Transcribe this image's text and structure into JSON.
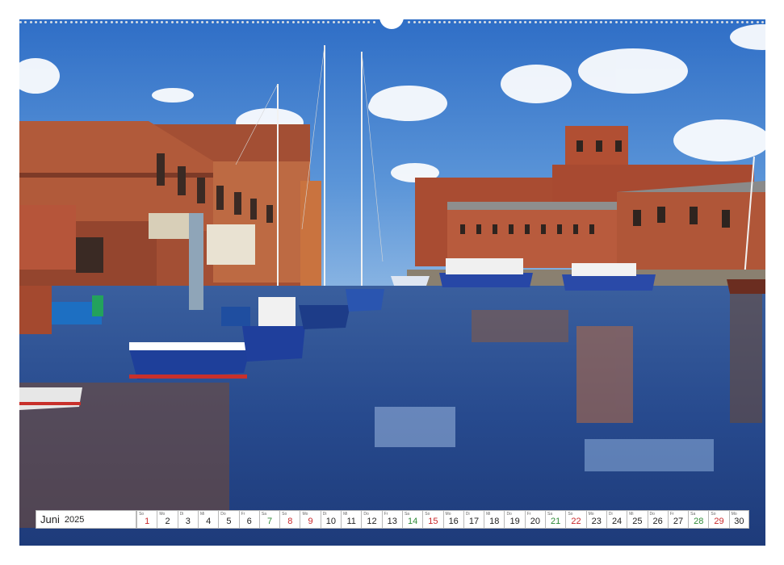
{
  "image_description_alt": "Harbour with boats, brick warehouses and reflections in calm water",
  "calendar": {
    "month": "Juni",
    "year": "2025",
    "days": [
      {
        "wd": "So",
        "num": "1",
        "type": "sun"
      },
      {
        "wd": "Mo",
        "num": "2",
        "type": "weekday"
      },
      {
        "wd": "Di",
        "num": "3",
        "type": "weekday"
      },
      {
        "wd": "Mi",
        "num": "4",
        "type": "weekday"
      },
      {
        "wd": "Do",
        "num": "5",
        "type": "weekday"
      },
      {
        "wd": "Fr",
        "num": "6",
        "type": "weekday"
      },
      {
        "wd": "Sa",
        "num": "7",
        "type": "sat"
      },
      {
        "wd": "So",
        "num": "8",
        "type": "sun"
      },
      {
        "wd": "Mo",
        "num": "9",
        "type": "sun"
      },
      {
        "wd": "Di",
        "num": "10",
        "type": "weekday"
      },
      {
        "wd": "Mi",
        "num": "11",
        "type": "weekday"
      },
      {
        "wd": "Do",
        "num": "12",
        "type": "weekday"
      },
      {
        "wd": "Fr",
        "num": "13",
        "type": "weekday"
      },
      {
        "wd": "Sa",
        "num": "14",
        "type": "sat"
      },
      {
        "wd": "So",
        "num": "15",
        "type": "sun"
      },
      {
        "wd": "Mo",
        "num": "16",
        "type": "weekday"
      },
      {
        "wd": "Di",
        "num": "17",
        "type": "weekday"
      },
      {
        "wd": "Mi",
        "num": "18",
        "type": "weekday"
      },
      {
        "wd": "Do",
        "num": "19",
        "type": "weekday"
      },
      {
        "wd": "Fr",
        "num": "20",
        "type": "weekday"
      },
      {
        "wd": "Sa",
        "num": "21",
        "type": "sat"
      },
      {
        "wd": "So",
        "num": "22",
        "type": "sun"
      },
      {
        "wd": "Mo",
        "num": "23",
        "type": "weekday"
      },
      {
        "wd": "Di",
        "num": "24",
        "type": "weekday"
      },
      {
        "wd": "Mi",
        "num": "25",
        "type": "weekday"
      },
      {
        "wd": "Do",
        "num": "26",
        "type": "weekday"
      },
      {
        "wd": "Fr",
        "num": "27",
        "type": "weekday"
      },
      {
        "wd": "Sa",
        "num": "28",
        "type": "sat"
      },
      {
        "wd": "So",
        "num": "29",
        "type": "sun"
      },
      {
        "wd": "Mo",
        "num": "30",
        "type": "weekday"
      }
    ]
  },
  "colors": {
    "sky": "#3f7fd0",
    "water": "#2a4f9a",
    "brick": "#9a4a30",
    "sunday": "#c8272a",
    "saturday": "#2f8a38"
  }
}
